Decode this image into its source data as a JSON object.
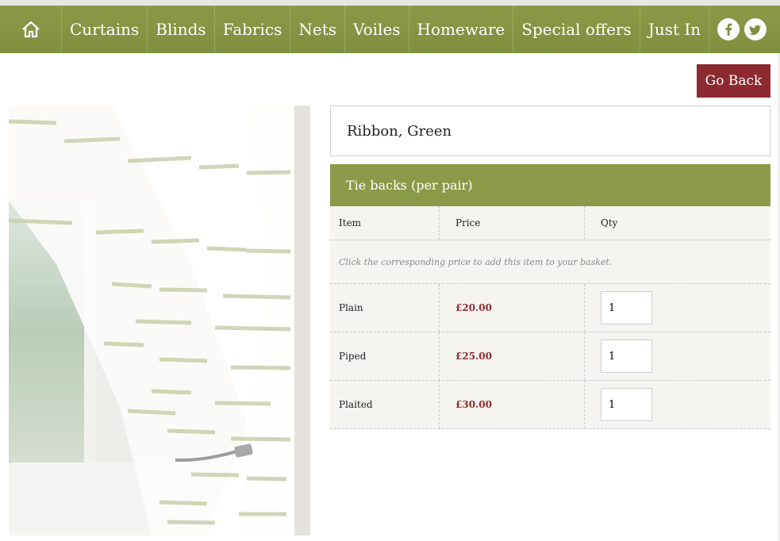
{
  "nav": {
    "items": [
      {
        "id": "curtains",
        "label": "Curtains"
      },
      {
        "id": "blinds",
        "label": "Blinds"
      },
      {
        "id": "fabrics",
        "label": "Fabrics"
      },
      {
        "id": "nets",
        "label": "Nets"
      },
      {
        "id": "voiles",
        "label": "Voiles"
      },
      {
        "id": "homeware",
        "label": "Homeware"
      },
      {
        "id": "special-offers",
        "label": "Special offers"
      },
      {
        "id": "just-in",
        "label": "Just In"
      }
    ],
    "home_icon": "home-icon",
    "social": [
      {
        "icon": "facebook-icon",
        "glyph": "f"
      },
      {
        "icon": "twitter-icon",
        "glyph": "t"
      }
    ]
  },
  "go_back_label": "Go Back",
  "product": {
    "title": "Ribbon, Green",
    "image_icon": "curtain-photo"
  },
  "section": {
    "title": "Tie backs (per pair)",
    "columns": {
      "item": "Item",
      "price": "Price",
      "qty": "Qty"
    },
    "hint": "Click the corresponding price to add this item to your basket.",
    "rows": [
      {
        "item": "Plain",
        "price": "£20.00",
        "qty": "1"
      },
      {
        "item": "Piped",
        "price": "£25.00",
        "qty": "1"
      },
      {
        "item": "Plaited",
        "price": "£30.00",
        "qty": "1"
      }
    ]
  },
  "colors": {
    "nav_green": "#8a9a48",
    "button_red": "#8d2a30",
    "price_red": "#8d2a30",
    "table_bg": "#f5f4f0"
  }
}
